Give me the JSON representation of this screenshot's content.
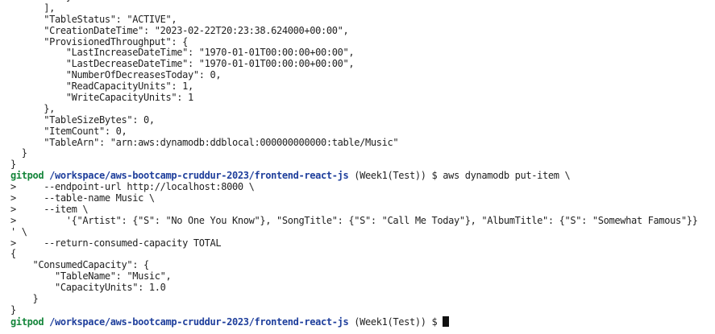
{
  "terminal": {
    "output_lines": [
      "          }",
      "      ],",
      "      \"TableStatus\": \"ACTIVE\",",
      "      \"CreationDateTime\": \"2023-02-22T20:23:38.624000+00:00\",",
      "      \"ProvisionedThroughput\": {",
      "          \"LastIncreaseDateTime\": \"1970-01-01T00:00:00+00:00\",",
      "          \"LastDecreaseDateTime\": \"1970-01-01T00:00:00+00:00\",",
      "          \"NumberOfDecreasesToday\": 0,",
      "          \"ReadCapacityUnits\": 1,",
      "          \"WriteCapacityUnits\": 1",
      "      },",
      "      \"TableSizeBytes\": 0,",
      "      \"ItemCount\": 0,",
      "      \"TableArn\": \"arn:aws:dynamodb:ddblocal:000000000000:table/Music\"",
      "  }",
      "}"
    ],
    "prompt1": {
      "user": "gitpod",
      "path": "/workspace/aws-bootcamp-cruddur-2023/frontend-react-js",
      "branch": "(Week1(Test))",
      "symbol": "$",
      "command": "aws dynamodb put-item \\"
    },
    "continuation_lines": [
      ">     --endpoint-url http://localhost:8000 \\",
      ">     --table-name Music \\",
      ">     --item \\",
      ">         '{\"Artist\": {\"S\": \"No One You Know\"}, \"SongTitle\": {\"S\": \"Call Me Today\"}, \"AlbumTitle\": {\"S\": \"Somewhat Famous\"}}",
      "' \\",
      ">     --return-consumed-capacity TOTAL"
    ],
    "result_lines": [
      "{",
      "    \"ConsumedCapacity\": {",
      "        \"TableName\": \"Music\",",
      "        \"CapacityUnits\": 1.0",
      "    }",
      "}"
    ],
    "prompt2": {
      "user": "gitpod",
      "path": "/workspace/aws-bootcamp-cruddur-2023/frontend-react-js",
      "branch": "(Week1(Test))",
      "symbol": "$"
    }
  }
}
